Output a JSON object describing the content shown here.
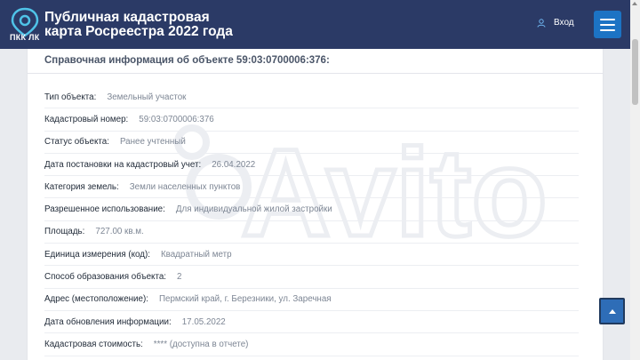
{
  "header": {
    "logo_text": "ПКК ЛК",
    "title_line1": "Публичная кадастровая",
    "title_line2": "карта Росреестра 2022 года",
    "login_label": "Вход"
  },
  "panel": {
    "title": "Справочная информация об объекте 59:03:0700006:376:",
    "rows": [
      {
        "label": "Тип объекта:",
        "value": "Земельный участок"
      },
      {
        "label": "Кадастровый номер:",
        "value": "59:03:0700006:376"
      },
      {
        "label": "Статус объекта:",
        "value": "Ранее учтенный"
      },
      {
        "label": "Дата постановки на кадастровый учет:",
        "value": "26.04.2022"
      },
      {
        "label": "Категория земель:",
        "value": "Земли населенных пунктов"
      },
      {
        "label": "Разрешенное использование:",
        "value": "Для индивидуальной жилой застройки"
      },
      {
        "label": "Площадь:",
        "value": "727.00 кв.м."
      },
      {
        "label": "Единица измерения (код):",
        "value": "Квадратный метр"
      },
      {
        "label": "Способ образования объекта:",
        "value": "2"
      },
      {
        "label": "Адрес (местоположение):",
        "value": "Пермский край, г. Березники, ул. Заречная"
      },
      {
        "label": "Дата обновления информации:",
        "value": "17.05.2022"
      },
      {
        "label": "Кадастровая стоимость:",
        "value": "**** (доступна в отчете)"
      }
    ]
  },
  "watermark_text": "Avito",
  "colors": {
    "header_bg": "#2b3a66",
    "accent": "#1c73c4",
    "label": "#1f2937",
    "value": "#7d8694"
  },
  "icons": {
    "logo": "location-pin-icon",
    "login": "user-icon",
    "menu": "hamburger-menu-icon",
    "scroll_top": "arrow-up-icon"
  }
}
